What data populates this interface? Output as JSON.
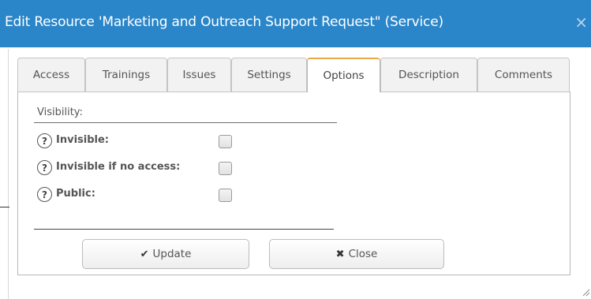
{
  "dialog": {
    "title": "Edit Resource 'Marketing and Outreach Support Request\" (Service)",
    "close_glyph": "×"
  },
  "tabs": [
    {
      "label": "Access",
      "active": false
    },
    {
      "label": "Trainings",
      "active": false
    },
    {
      "label": "Issues",
      "active": false
    },
    {
      "label": "Settings",
      "active": false
    },
    {
      "label": "Options",
      "active": true
    },
    {
      "label": "Description",
      "active": false
    },
    {
      "label": "Comments",
      "active": false
    }
  ],
  "options": {
    "section_label": "Visibility:",
    "help_glyph": "?",
    "items": [
      {
        "label": "Invisible:",
        "checked": false
      },
      {
        "label": "Invisible if no access:",
        "checked": false
      },
      {
        "label": "Public:",
        "checked": false
      }
    ]
  },
  "buttons": {
    "update_icon": "✔",
    "update_label": "Update",
    "close_icon": "✖",
    "close_label": "Close"
  },
  "colors": {
    "titlebar": "#2b86c9",
    "active_tab_accent": "#e9a845"
  }
}
